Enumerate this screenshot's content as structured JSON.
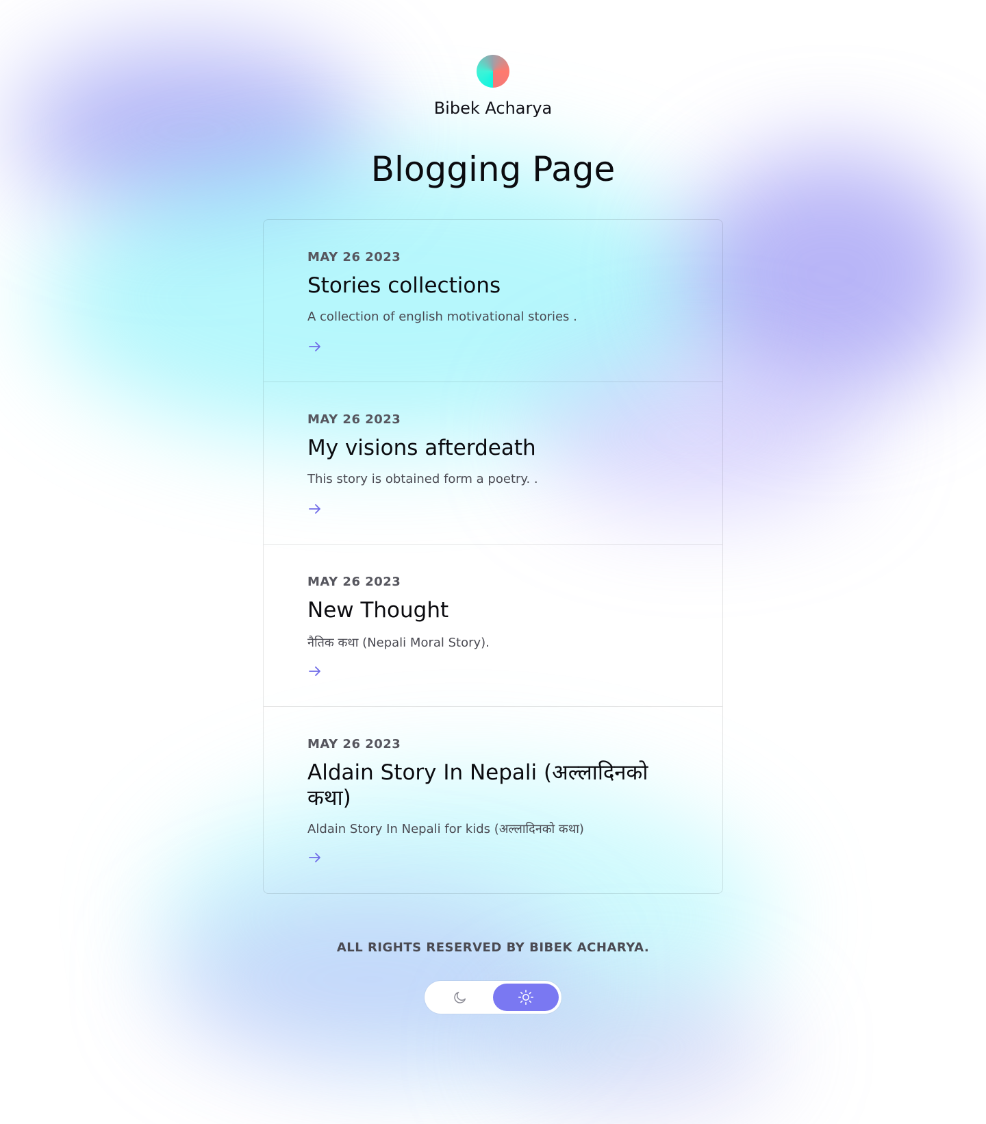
{
  "header": {
    "author_name": "Bibek Acharya",
    "page_title": "Blogging Page"
  },
  "posts": [
    {
      "date": "MAY 26 2023",
      "title": "Stories collections",
      "description": "A collection of english motivational stories ."
    },
    {
      "date": "MAY 26 2023",
      "title": "My visions afterdeath",
      "description": "This story is obtained form a poetry. ."
    },
    {
      "date": "MAY 26 2023",
      "title": "New Thought",
      "description": "नैतिक कथा (Nepali Moral Story)."
    },
    {
      "date": "MAY 26 2023",
      "title": "Aldain Story In Nepali (अल्लादिनको कथा)",
      "description": "Aldain Story In Nepali for kids (अल्लादिनको कथा)"
    }
  ],
  "footer": {
    "copyright": "ALL RIGHTS RESERVED BY BIBEK ACHARYA."
  },
  "theme_toggle": {
    "dark_icon": "moon-icon",
    "light_icon": "sun-icon",
    "active": "light"
  },
  "colors": {
    "accent": "#7a78f2",
    "arrow": "#6f6be8"
  }
}
